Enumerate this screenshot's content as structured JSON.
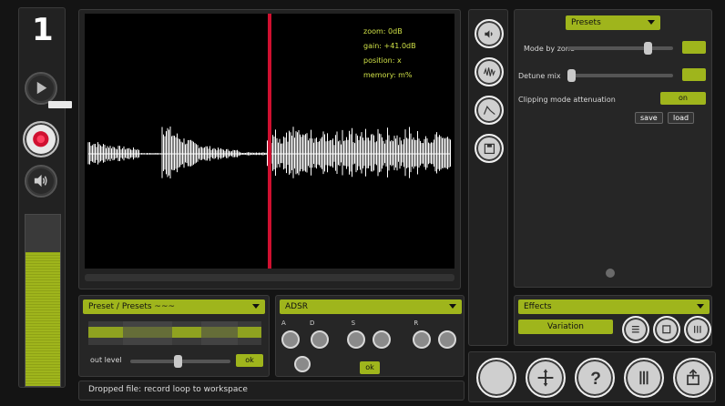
{
  "channel": {
    "number": "1"
  },
  "waveform": {
    "stats": [
      {
        "label": "zoom:",
        "value": "0dB"
      },
      {
        "label": "gain:",
        "value": "+41.0dB"
      },
      {
        "label": "position:",
        "value": "x"
      },
      {
        "label": "memory:",
        "value": "m%"
      }
    ],
    "playhead_fraction": 0.5
  },
  "level_meter": {
    "fill_fraction": 0.78
  },
  "left_panel": {
    "title": "Preset / Presets ~~~",
    "out_label": "out level",
    "value": "ok"
  },
  "mid_panel": {
    "title": "ADSR",
    "labels": [
      "A",
      "D",
      "S",
      "R"
    ],
    "value": "ok"
  },
  "right_panel": {
    "top_dropdown": "Presets",
    "row1_label": "Mode by zone",
    "row2_label": "Detune mix",
    "row3_label": "Clipping mode attenuation",
    "row3_value": "on",
    "opt_a": "save",
    "opt_b": "load"
  },
  "lower_right": {
    "dropdown": "Effects",
    "button": "Variation"
  },
  "status_bar": {
    "text": "Dropped file: record loop to workspace"
  },
  "colors": {
    "accent": "#9fb51c",
    "playhead": "#d01030",
    "background": "#141414"
  }
}
